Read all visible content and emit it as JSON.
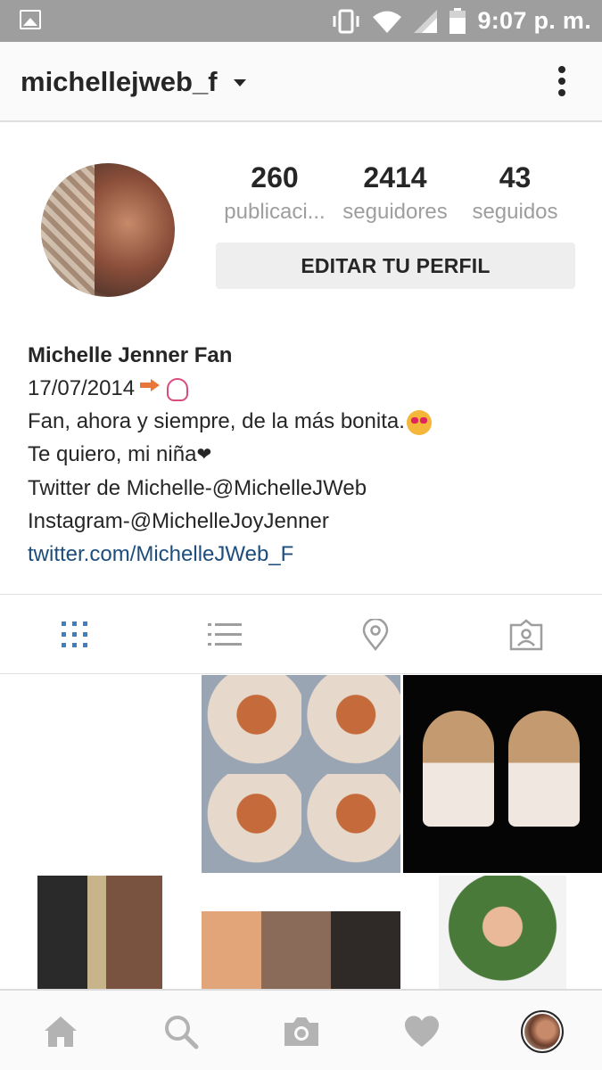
{
  "status_bar": {
    "time": "9:07 p. m.",
    "icons": [
      "image-icon",
      "vibrate-icon",
      "wifi-icon",
      "signal-icon",
      "battery-icon"
    ]
  },
  "header": {
    "username": "michellejweb_f",
    "icons": [
      "dropdown-caret-icon",
      "more-options-icon"
    ]
  },
  "profile": {
    "stats": [
      {
        "value": "260",
        "label": "publicaci..."
      },
      {
        "value": "2414",
        "label": "seguidores"
      },
      {
        "value": "43",
        "label": "seguidos"
      }
    ],
    "edit_button": "EDITAR TU PERFIL"
  },
  "bio": {
    "name": "Michelle Jenner Fan",
    "date": "17/07/2014",
    "line1": "Fan, ahora y siempre, de la más bonita.",
    "line2": "Te quiero, mi niña",
    "line3": "Twitter de Michelle-@MichelleJWeb",
    "line4": "Instagram-@MichelleJoyJenner",
    "link": "twitter.com/MichelleJWeb_F",
    "emoji": [
      "soon-arrow-icon",
      "ok-hand-icon",
      "heart-eyes-icon",
      "heart-icon"
    ]
  },
  "tabs": {
    "items": [
      "grid-view-icon",
      "list-view-icon",
      "location-icon",
      "tagged-icon"
    ],
    "active": "grid-view-icon",
    "active_color": "#3f7fbf"
  },
  "nav": {
    "items": [
      "home-icon",
      "search-icon",
      "camera-icon",
      "heart-icon",
      "profile-icon"
    ]
  }
}
